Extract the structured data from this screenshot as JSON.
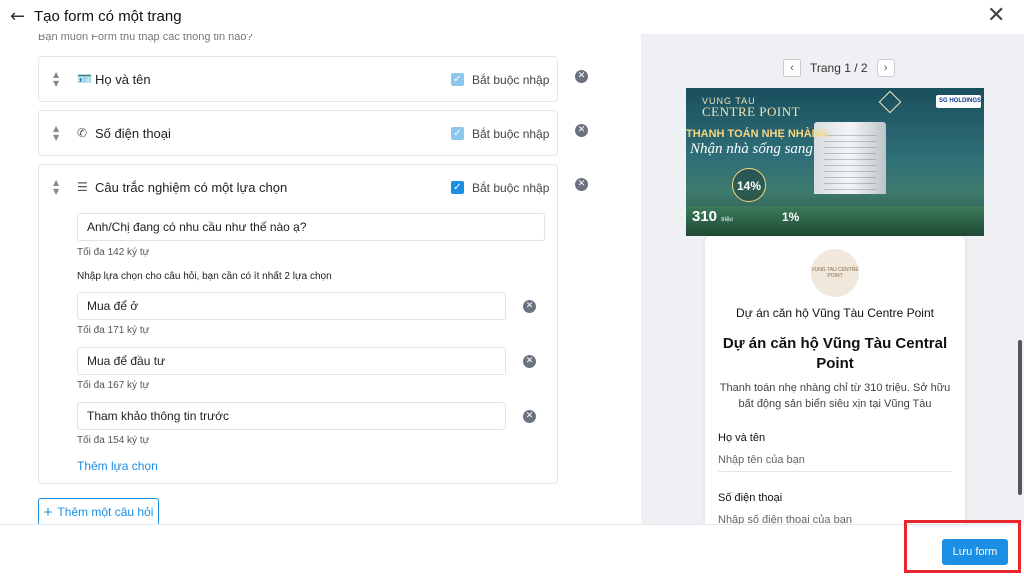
{
  "header": {
    "title": "Tạo form có một trang",
    "back_icon": "arrow-left-icon",
    "close_icon": "close-icon"
  },
  "left": {
    "cut_text": "Bạn muốn Form thu thập các thông tin nào?",
    "questions": [
      {
        "label": "Họ và tên",
        "icon": "id-card-icon",
        "required_label": "Bắt buộc nhập"
      },
      {
        "label": "Số điện thoại",
        "icon": "phone-icon",
        "required_label": "Bắt buộc nhập"
      },
      {
        "label": "Câu trắc nghiệm có một lựa chọn",
        "icon": "list-icon",
        "required_label": "Bắt buộc nhập"
      }
    ],
    "mc": {
      "question_value": "Anh/Chị đang có nhu cầu như thế nào ạ?",
      "question_hint": "Tối đa 142 ký tự",
      "options_label": "Nhập lựa chọn cho câu hỏi, bạn cần có ít nhất 2 lựa chọn",
      "options": [
        {
          "value": "Mua để ở",
          "hint": "Tối đa 171 ký tự"
        },
        {
          "value": "Mua để đầu tư",
          "hint": "Tối đa 167 ký tự"
        },
        {
          "value": "Tham khảo thông tin trước",
          "hint": "Tối đa 154 ký tự"
        }
      ],
      "add_option": "Thêm lựa chọn"
    },
    "add_question": "Thêm một câu hỏi"
  },
  "preview": {
    "page_label": "Trang 1 / 2",
    "banner": {
      "brand_top": "VUNG TAU",
      "brand_name": "CENTRE POINT",
      "logo2": "SG HOLDINGS",
      "headline": "THANH TOÁN NHẸ NHÀNG",
      "script": "Nhận nhà sống sang",
      "pct": "14%",
      "price": "310",
      "price_unit": "triệu",
      "pct2": "1%"
    },
    "logo_text": "VUNG TAU CENTRE POINT",
    "subtitle": "Dự án căn hộ Vũng Tàu Centre Point",
    "title": "Dự án căn hộ Vũng Tàu Central Point",
    "description": "Thanh toán nhẹ nhàng chỉ từ 310 triệu. Sở hữu bất động sản biển siêu xịn tại Vũng Tàu",
    "fields": [
      {
        "label": "Họ và tên",
        "placeholder": "Nhập tên của bạn"
      },
      {
        "label": "Số điện thoại",
        "placeholder": "Nhập số điện thoại của bạn"
      }
    ]
  },
  "footer": {
    "save_label": "Lưu form"
  },
  "colors": {
    "accent": "#1a8fe3",
    "highlight": "#e8262e"
  }
}
